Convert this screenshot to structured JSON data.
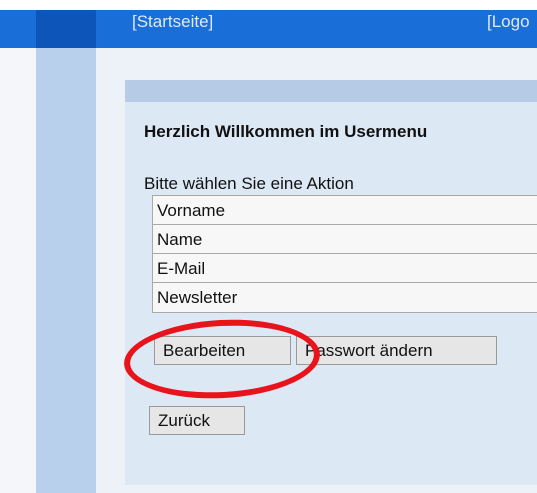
{
  "nav": {
    "home_label": "[Startseite]",
    "logout_label": "[Logo"
  },
  "welcome_heading": "Herzlich Willkommen im Usermenu",
  "prompt_text": "Bitte wählen Sie eine Aktion",
  "fields": [
    "Vorname",
    "Name",
    "E-Mail",
    "Newsletter"
  ],
  "buttons": {
    "edit_label": "Bearbeiten",
    "change_password_label": "Passwort ändern",
    "back_label": "Zurück"
  },
  "colors": {
    "header_blue": "#1a6ed8",
    "panel_blue": "#dde8f5",
    "annotation_red": "#e8131b"
  }
}
